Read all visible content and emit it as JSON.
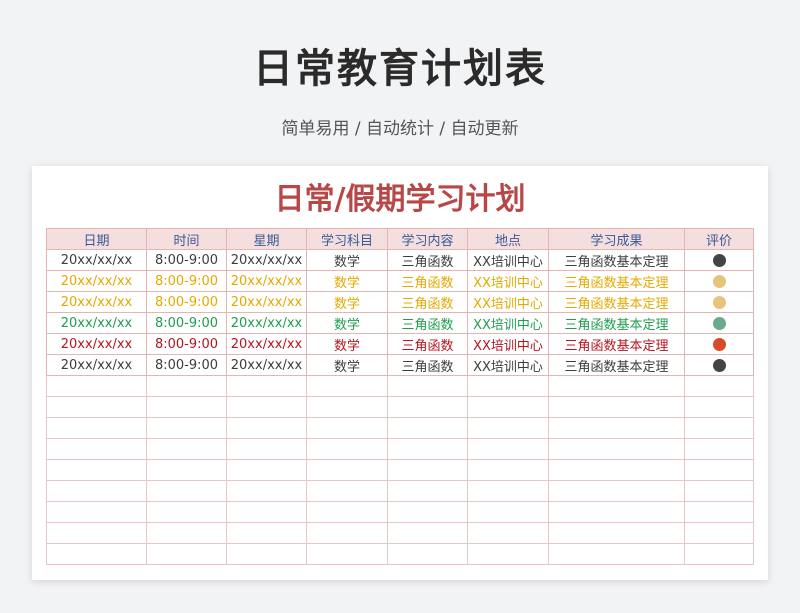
{
  "header": {
    "title": "日常教育计划表",
    "subtitle": "简单易用 / 自动统计 / 自动更新"
  },
  "sheet": {
    "title": "日常/假期学习计划",
    "columns": [
      "日期",
      "时间",
      "星期",
      "学习科目",
      "学习内容",
      "地点",
      "学习成果",
      "评价"
    ],
    "rows": [
      {
        "date": "20xx/xx/xx",
        "time": "8:00-9:00",
        "week": "20xx/xx/xx",
        "subject": "数学",
        "content": "三角函数",
        "place": "XX培训中心",
        "result": "三角函数基本定理",
        "color": "#3d3d3d",
        "dot_color": "#444444"
      },
      {
        "date": "20xx/xx/xx",
        "time": "8:00-9:00",
        "week": "20xx/xx/xx",
        "subject": "数学",
        "content": "三角函数",
        "place": "XX培训中心",
        "result": "三角函数基本定理",
        "color": "#e6a800",
        "dot_color": "#e8c37c"
      },
      {
        "date": "20xx/xx/xx",
        "time": "8:00-9:00",
        "week": "20xx/xx/xx",
        "subject": "数学",
        "content": "三角函数",
        "place": "XX培训中心",
        "result": "三角函数基本定理",
        "color": "#e6a800",
        "dot_color": "#e8c37c"
      },
      {
        "date": "20xx/xx/xx",
        "time": "8:00-9:00",
        "week": "20xx/xx/xx",
        "subject": "数学",
        "content": "三角函数",
        "place": "XX培训中心",
        "result": "三角函数基本定理",
        "color": "#1f9d4f",
        "dot_color": "#6aaa8e"
      },
      {
        "date": "20xx/xx/xx",
        "time": "8:00-9:00",
        "week": "20xx/xx/xx",
        "subject": "数学",
        "content": "三角函数",
        "place": "XX培训中心",
        "result": "三角函数基本定理",
        "color": "#b8141f",
        "dot_color": "#d94a2a"
      },
      {
        "date": "20xx/xx/xx",
        "time": "8:00-9:00",
        "week": "20xx/xx/xx",
        "subject": "数学",
        "content": "三角函数",
        "place": "XX培训中心",
        "result": "三角函数基本定理",
        "color": "#3d3d3d",
        "dot_color": "#444444"
      }
    ],
    "empty_rows": 9
  }
}
